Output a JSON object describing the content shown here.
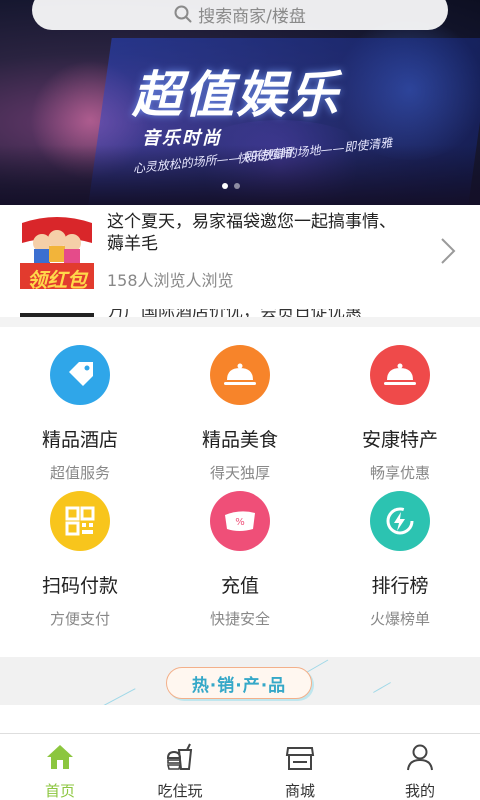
{
  "search": {
    "placeholder": "搜索商家/楼盘"
  },
  "banner": {
    "title": "超值娱乐",
    "subtitle": "音乐时尚",
    "line1": "心灵放松的场所—— 即使喧闹",
    "line2": "快乐放肆的场地——即使清雅",
    "active_dot": 1
  },
  "news": {
    "title": "这个夏天，易家福袋邀您一起搞事情、薅羊毛",
    "meta": "158人浏览人浏览",
    "thumb_text": "领红包",
    "next_title": "万广国际酒店价优，会员日促优惠"
  },
  "grid": {
    "items": [
      {
        "label": "精品酒店",
        "sub": "超值服务",
        "icon": "tag-icon",
        "color": "#2fa6e9"
      },
      {
        "label": "精品美食",
        "sub": "得天独厚",
        "icon": "food-cloche-icon",
        "color": "#f7842a"
      },
      {
        "label": "安康特产",
        "sub": "畅享优惠",
        "icon": "cloche-icon",
        "color": "#ef4a4a"
      },
      {
        "label": "扫码付款",
        "sub": "方便支付",
        "icon": "qrcode-icon",
        "color": "#f8c51c"
      },
      {
        "label": "充值",
        "sub": "快捷安全",
        "icon": "coupon-icon",
        "color": "#ef4f78"
      },
      {
        "label": "排行榜",
        "sub": "火爆榜单",
        "icon": "lightning-icon",
        "color": "#2cc3b1"
      }
    ]
  },
  "hot": {
    "title": "热·销·产·品"
  },
  "tabs": [
    {
      "label": "首页",
      "icon": "home-icon",
      "active": true
    },
    {
      "label": "吃住玩",
      "icon": "drink-icon",
      "active": false
    },
    {
      "label": "商城",
      "icon": "store-icon",
      "active": false
    },
    {
      "label": "我的",
      "icon": "user-icon",
      "active": false
    }
  ],
  "colors": {
    "accent": "#8cc63f",
    "hot_text": "#35a8c8"
  }
}
